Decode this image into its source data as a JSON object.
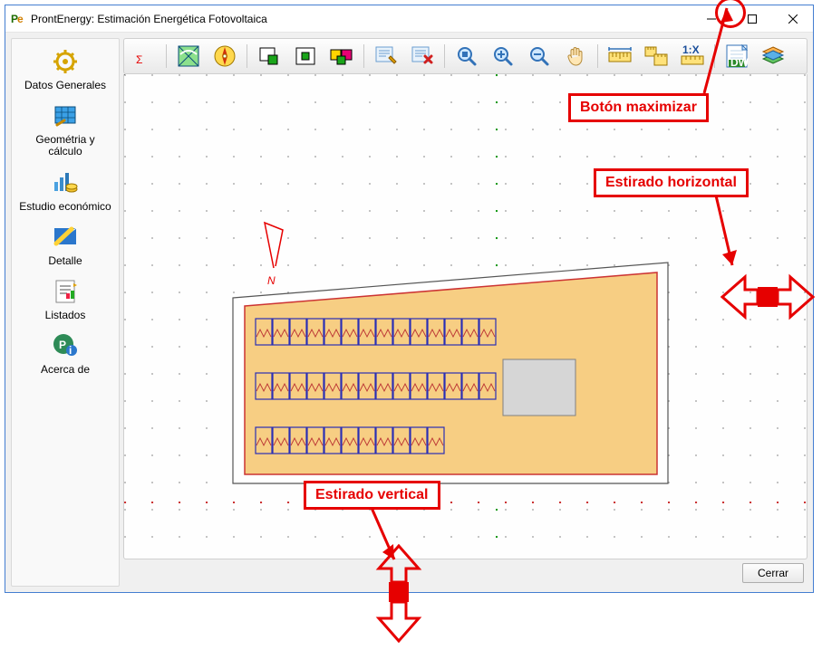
{
  "window": {
    "title": "ProntEnergy: Estimación Energética Fotovoltaica",
    "icon_label": "Pe"
  },
  "sidebar": {
    "items": [
      {
        "name": "sidebar-general-data",
        "label": "Datos Generales"
      },
      {
        "name": "sidebar-geometry-calc",
        "label": "Geométria y cálculo"
      },
      {
        "name": "sidebar-eco-study",
        "label": "Estudio económico"
      },
      {
        "name": "sidebar-detail",
        "label": "Detalle"
      },
      {
        "name": "sidebar-listings",
        "label": "Listados"
      },
      {
        "name": "sidebar-about",
        "label": "Acerca de"
      }
    ]
  },
  "toolbar": {
    "items": [
      {
        "name": "tool-sum",
        "icon": "sigma"
      },
      {
        "name": "tool-roof",
        "icon": "roof"
      },
      {
        "name": "tool-compass",
        "icon": "compass"
      },
      {
        "name": "tool-rect-out",
        "icon": "rect-out"
      },
      {
        "name": "tool-rect-in",
        "icon": "rect-in"
      },
      {
        "name": "tool-rect-color",
        "icon": "rect-color"
      },
      {
        "name": "tool-form-edit",
        "icon": "form-edit"
      },
      {
        "name": "tool-form-delete",
        "icon": "form-delete"
      },
      {
        "name": "tool-zoom-extents",
        "icon": "mag-blue"
      },
      {
        "name": "tool-zoom-in",
        "icon": "mag-plus"
      },
      {
        "name": "tool-zoom-out",
        "icon": "mag-minus"
      },
      {
        "name": "tool-pan",
        "icon": "hand"
      },
      {
        "name": "tool-measure",
        "icon": "ruler"
      },
      {
        "name": "tool-measure-area",
        "icon": "ruler-area"
      },
      {
        "name": "tool-scale",
        "icon": "scale-1x"
      },
      {
        "name": "tool-dwg",
        "icon": "dwg"
      },
      {
        "name": "tool-layers",
        "icon": "layers"
      }
    ],
    "scale_label": "1:X",
    "dwg_label": "DWG"
  },
  "footer": {
    "close_label": "Cerrar"
  },
  "canvas": {
    "north_indicator": "N",
    "panel_rows": [
      {
        "count": 14
      },
      {
        "count": 14
      },
      {
        "count": 11
      }
    ]
  },
  "annotations": {
    "maximize_label": "Botón maximizar",
    "h_stretch_label": "Estirado horizontal",
    "v_stretch_label": "Estirado vertical"
  },
  "colors": {
    "accent_red": "#e60000",
    "roof_fill": "#f7ce83",
    "panel_stroke": "#2a2fb5"
  }
}
